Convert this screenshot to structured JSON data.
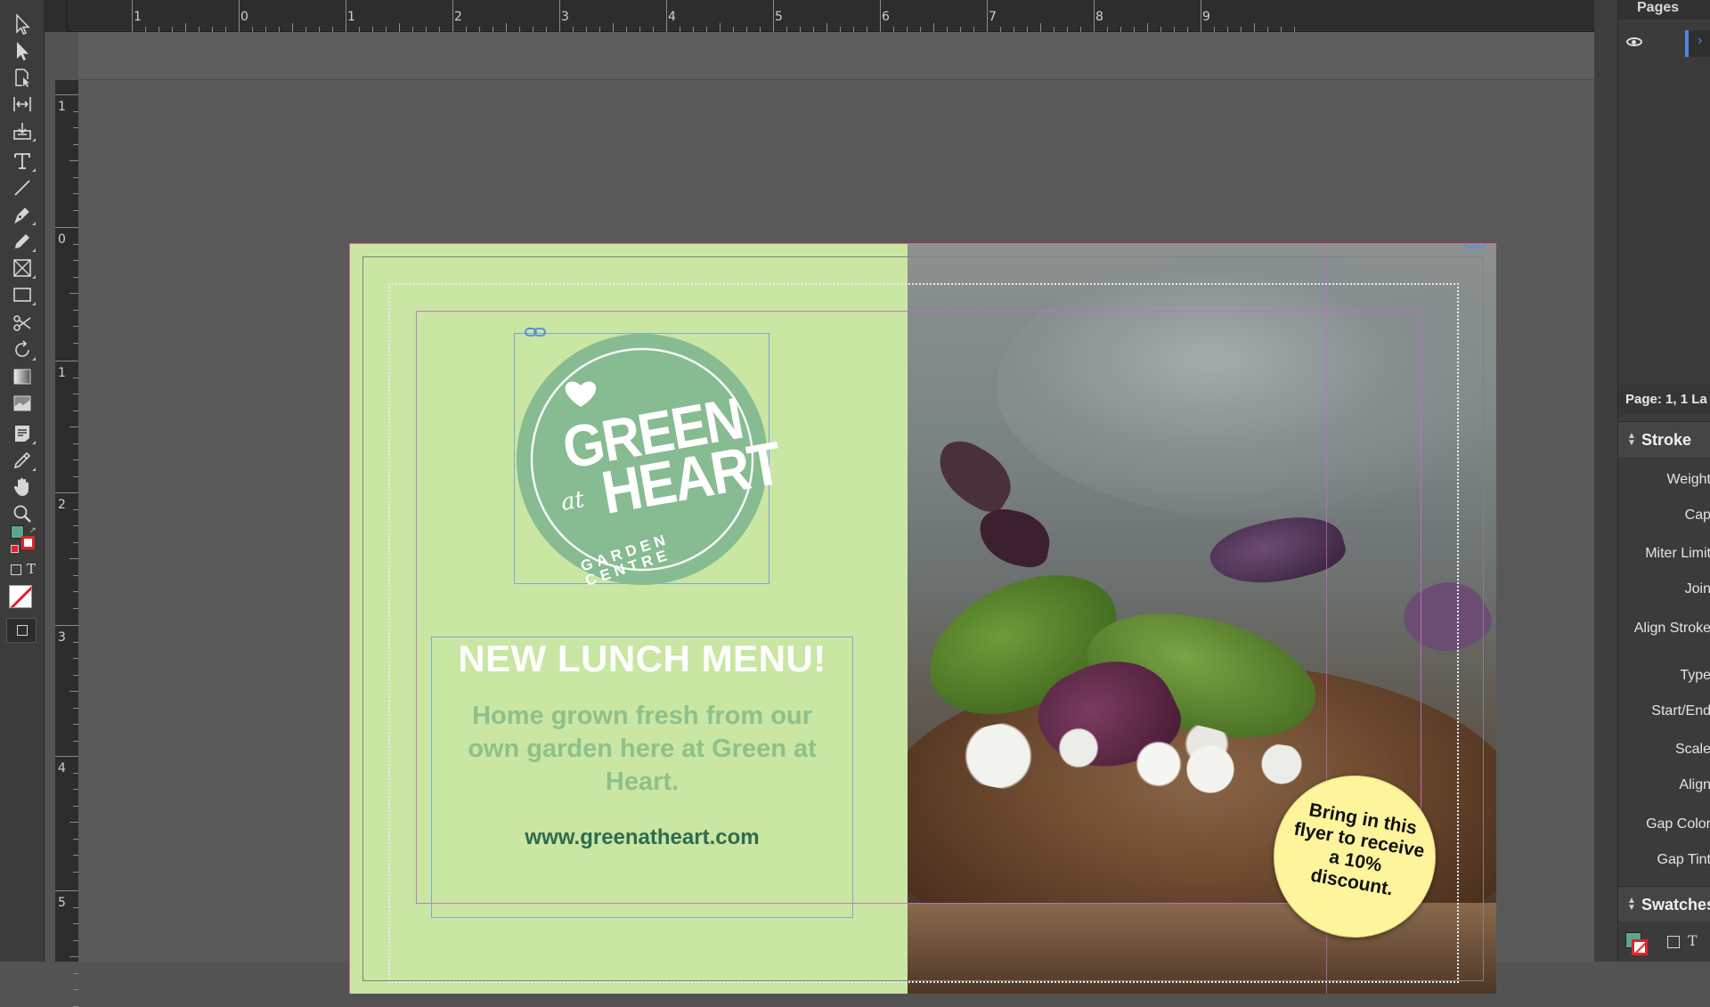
{
  "toolbar": {
    "tools": [
      "selection-tool",
      "direct-selection-tool",
      "page-tool",
      "gap-tool",
      "content-collector-tool",
      "type-tool",
      "line-tool",
      "pen-tool",
      "pencil-tool",
      "rectangle-frame-tool",
      "rectangle-tool",
      "scissors-tool",
      "free-transform-tool",
      "gradient-swatch-tool",
      "gradient-feather-tool",
      "note-tool",
      "eyedropper-tool",
      "hand-tool",
      "zoom-tool"
    ],
    "fill_color": "#5aa68a",
    "stroke_color": "#e0242a"
  },
  "rulers": {
    "horizontal": [
      "1",
      "0",
      "1",
      "2",
      "3",
      "4",
      "5",
      "6",
      "7",
      "8",
      "9"
    ],
    "vertical": [
      "1",
      "0",
      "1",
      "2",
      "3",
      "4",
      "5"
    ]
  },
  "document": {
    "green_panel_color": "#c9e6a2",
    "logo": {
      "line1": "GREEN",
      "line2": "at",
      "line3": "HEART",
      "ring_text": "GARDEN CENTRE",
      "color": "#87bb91"
    },
    "headline": "NEW LUNCH MENU!",
    "body": "Home grown fresh from our own garden here at Green at Heart.",
    "website": "www.greenatheart.com",
    "badge": {
      "text": "Bring in this flyer to receive a 10% discount.",
      "color": "#fdf49b"
    }
  },
  "panels": {
    "pages_tab": "Pages",
    "page_info": "Page: 1, 1 La",
    "stroke": {
      "title": "Stroke",
      "labels": [
        "Weight",
        "Cap",
        "Miter Limit",
        "Join",
        "Align Stroke",
        "Type",
        "Start/End",
        "Scale",
        "Align",
        "Gap Color",
        "Gap Tint"
      ]
    },
    "swatches": {
      "title": "Swatches"
    }
  }
}
